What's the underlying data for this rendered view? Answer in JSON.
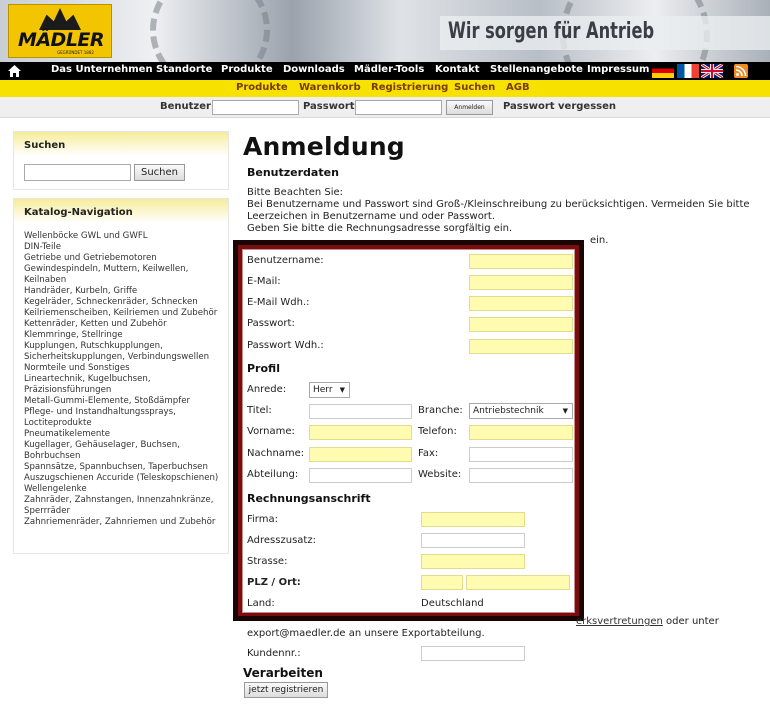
{
  "header": {
    "logo_text": "MÄDLER",
    "logo_subtext": "GEGRÜNDET 1882",
    "slogan": "Wir sorgen für Antrieb"
  },
  "topnav": {
    "items": [
      "Das Unternehmen",
      "Standorte",
      "Produkte",
      "Downloads",
      "Mädler-Tools",
      "Kontakt",
      "Stellenangebote",
      "Impressum"
    ]
  },
  "subnav": {
    "items": [
      "Produkte",
      "Warenkorb",
      "Registrierung",
      "Suchen",
      "AGB"
    ]
  },
  "loginbar": {
    "user_label": "Benutzer:",
    "password_label": "Passwort:",
    "login_button": "Anmelden",
    "forgot_link": "Passwort vergessen"
  },
  "sidebar": {
    "search_title": "Suchen",
    "search_button": "Suchen",
    "catalog_title": "Katalog-Navigation",
    "catalog_items": [
      "Wellenböcke GWL und GWFL",
      "DIN-Teile",
      "Getriebe und Getriebemotoren",
      "Gewindespindeln, Muttern, Keilwellen, Keilnaben",
      "Handräder, Kurbeln, Griffe",
      "Kegelräder, Schneckenräder, Schnecken",
      "Keilriemenscheiben, Keilriemen und Zubehör",
      "Kettenräder, Ketten und Zubehör",
      "Klemmringe, Stellringe",
      "Kupplungen, Rutschkupplungen, Sicherheitskupplungen, Verbindungswellen",
      "Normteile und Sonstiges",
      "Lineartechnik, Kugelbuchsen, Präzisionsführungen",
      "Metall-Gummi-Elemente, Stoßdämpfer",
      "Pflege- und Instandhaltungssprays, Loctiteprodukte",
      "Pneumatikelemente",
      "Kugellager, Gehäuselager, Buchsen, Bohrbuchsen",
      "Spannsätze, Spannbuchsen, Taperbuchsen",
      "Auszugschienen Accuride (Teleskopschienen)",
      "Wellengelenke",
      "Zahnräder, Zahnstangen, Innenzahnkränze, Sperrräder",
      "Zahnriemenräder, Zahnriemen und Zubehör"
    ]
  },
  "main": {
    "title": "Anmeldung",
    "section": "Benutzerdaten",
    "intro_1": "Bitte Beachten Sie:",
    "intro_2": "Bei Benutzername und Passwort sind Groß-/Kleinschreibung zu berücksichtigen. Vermeiden Sie bitte Leerzeichen in Benutzername und oder Passwort.",
    "intro_3": "Geben Sie bitte die Rechnungsadresse sorgfältig ein.",
    "intro_4_partial": "ein."
  },
  "form": {
    "username": "Benutzername:",
    "email": "E-Mail:",
    "email_repeat": "E-Mail Wdh.:",
    "password": "Passwort:",
    "password_repeat": "Passwort Wdh.:",
    "profile_title": "Profil",
    "salutation_label": "Anrede:",
    "salutation_value": "Herr",
    "title_label": "Titel:",
    "industry_label": "Branche:",
    "industry_value": "Antriebstechnik",
    "firstname": "Vorname:",
    "phone": "Telefon:",
    "lastname": "Nachname:",
    "fax": "Fax:",
    "department": "Abteilung:",
    "website": "Website:",
    "billing_title": "Rechnungsanschrift",
    "company": "Firma:",
    "address_extra": "Adresszusatz:",
    "street": "Strasse:",
    "zip_city": "PLZ / Ort:",
    "country_label": "Land:",
    "country_value": "Deutschland"
  },
  "after_frame": {
    "link_partial": "erksvertretungen",
    "text_after_link": "oder unter",
    "export_line": "export@maedler.de an unsere Exportabteilung.",
    "customer_no": "Kundennr.:",
    "process_title": "Verarbeiten",
    "register_button": "jetzt registrieren"
  }
}
